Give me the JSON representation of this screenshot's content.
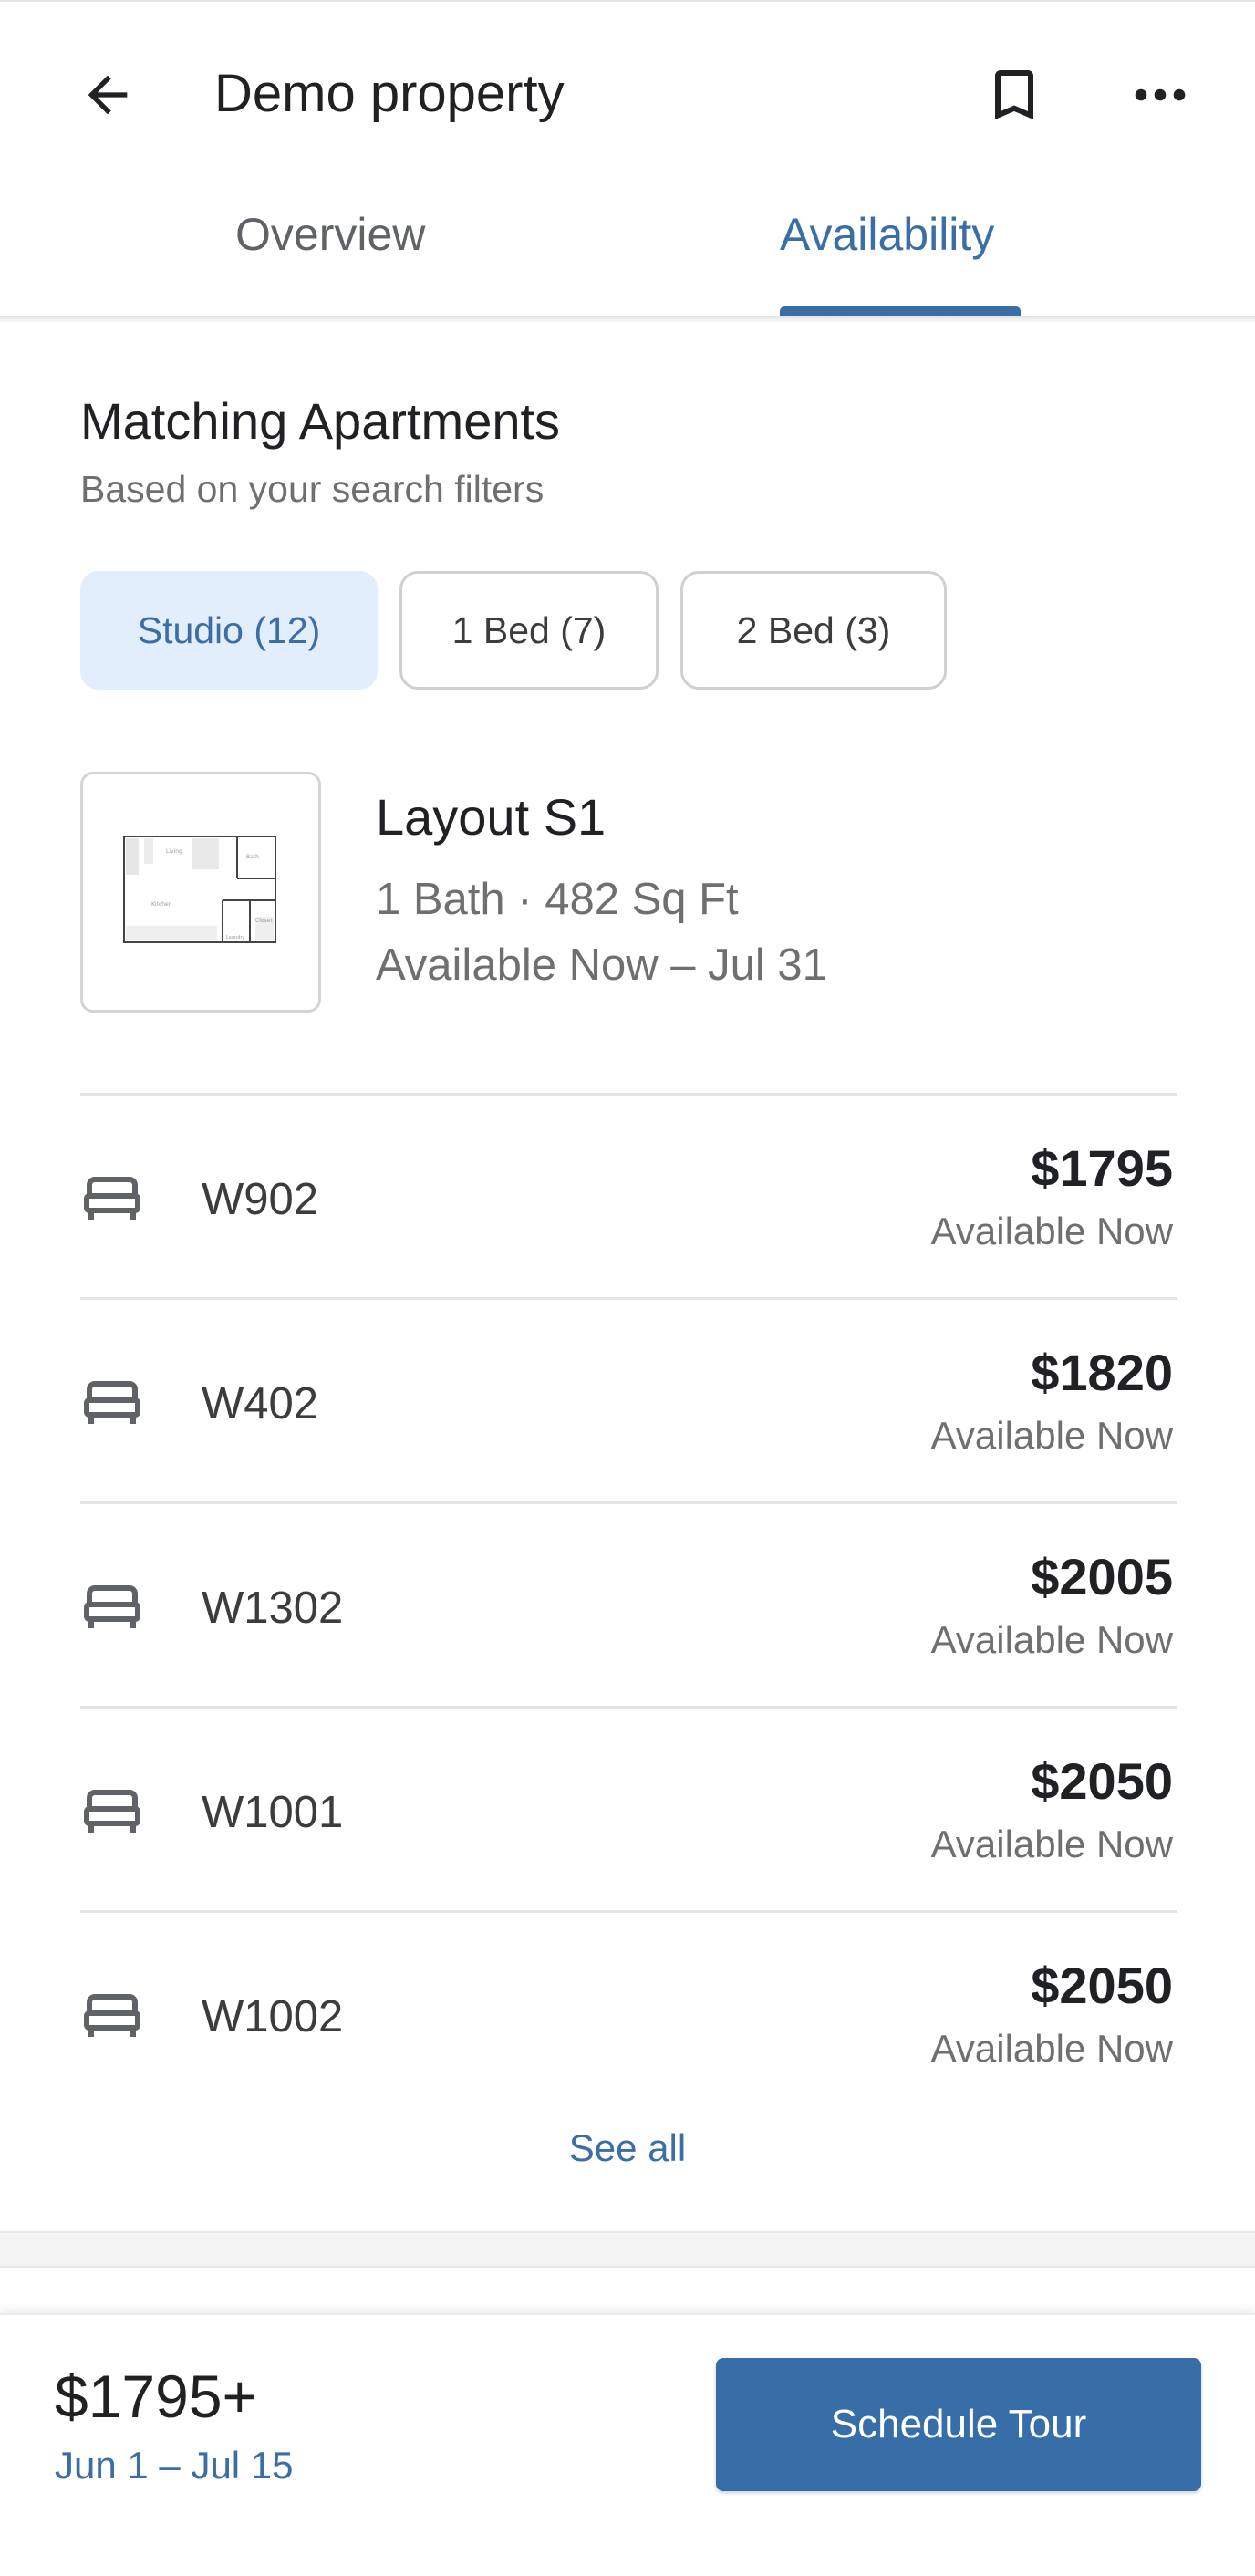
{
  "colors": {
    "accent": "#3a6ea5",
    "chip_selected_bg": "#e3eefc",
    "button_bg": "#386ea8",
    "text_primary": "#202124",
    "text_secondary": "#6f6f6f"
  },
  "header": {
    "title": "Demo property",
    "icons": [
      "back-arrow-icon",
      "bookmark-icon",
      "more-horizontal-icon"
    ]
  },
  "tabs": [
    {
      "label": "Overview",
      "active": false
    },
    {
      "label": "Availability",
      "active": true
    }
  ],
  "section": {
    "title": "Matching Apartments",
    "subtitle": "Based on your search filters"
  },
  "filters": [
    {
      "label": "Studio (12)",
      "selected": true
    },
    {
      "label": "1 Bed (7)",
      "selected": false
    },
    {
      "label": "2 Bed (3)",
      "selected": false
    }
  ],
  "layout": {
    "name": "Layout S1",
    "details": "1 Bath · 482 Sq Ft",
    "availability": "Available Now – Jul 31"
  },
  "units": [
    {
      "name": "W902",
      "price": "$1795",
      "status": "Available Now",
      "icon": "bed-icon"
    },
    {
      "name": "W402",
      "price": "$1820",
      "status": "Available Now",
      "icon": "bed-icon"
    },
    {
      "name": "W1302",
      "price": "$2005",
      "status": "Available Now",
      "icon": "bed-icon"
    },
    {
      "name": "W1001",
      "price": "$2050",
      "status": "Available Now",
      "icon": "bed-icon"
    },
    {
      "name": "W1002",
      "price": "$2050",
      "status": "Available Now",
      "icon": "bed-icon"
    }
  ],
  "see_all": "See all",
  "bottom_bar": {
    "price": "$1795+",
    "dates": "Jun 1 – Jul 15",
    "cta": "Schedule Tour"
  }
}
